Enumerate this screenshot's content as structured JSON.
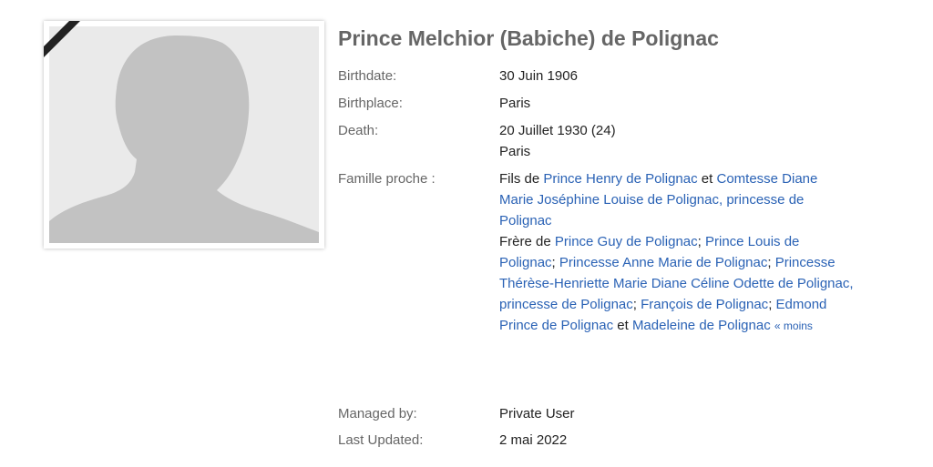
{
  "profile": {
    "name": "Prince Melchior (Babiche) de Polignac"
  },
  "facts": {
    "birthdate_label": "Birthdate:",
    "birthdate_value": "30 Juin 1906",
    "birthplace_label": "Birthplace:",
    "birthplace_value": "Paris",
    "death_label": "Death:",
    "death_date": "20 Juillet 1930 (24)",
    "death_place": "Paris",
    "family_label": "Famille proche :",
    "managed_label": "Managed by:",
    "managed_value": "Private User",
    "updated_label": "Last Updated:",
    "updated_value": "2 mai 2022"
  },
  "family": {
    "son_of_prefix": "Fils de",
    "father": "Prince Henry de Polignac",
    "and1": "et",
    "mother": "Comtesse Diane Marie Joséphine Louise de Polignac, princesse de Polignac",
    "brother_of_prefix": "Frère de",
    "siblings": [
      "Prince Guy de Polignac",
      "Prince Louis de Polignac",
      "Princesse Anne Marie de Polignac",
      "Princesse Thérèse-Henriette Marie Diane Céline Odette de Polignac, princesse de Polignac",
      "François de Polignac",
      "Edmond Prince de Polignac"
    ],
    "sep": ";",
    "and2": "et",
    "last_sibling": "Madeleine de Polignac",
    "less_link": "« moins"
  },
  "colors": {
    "link": "#2a62b5",
    "label": "#666666",
    "placeholder_bg": "#eaeaea",
    "silhouette": "#c2c2c2"
  },
  "icons": {
    "photo": "profile-silhouette-icon",
    "ribbon": "mourning-ribbon-icon"
  }
}
